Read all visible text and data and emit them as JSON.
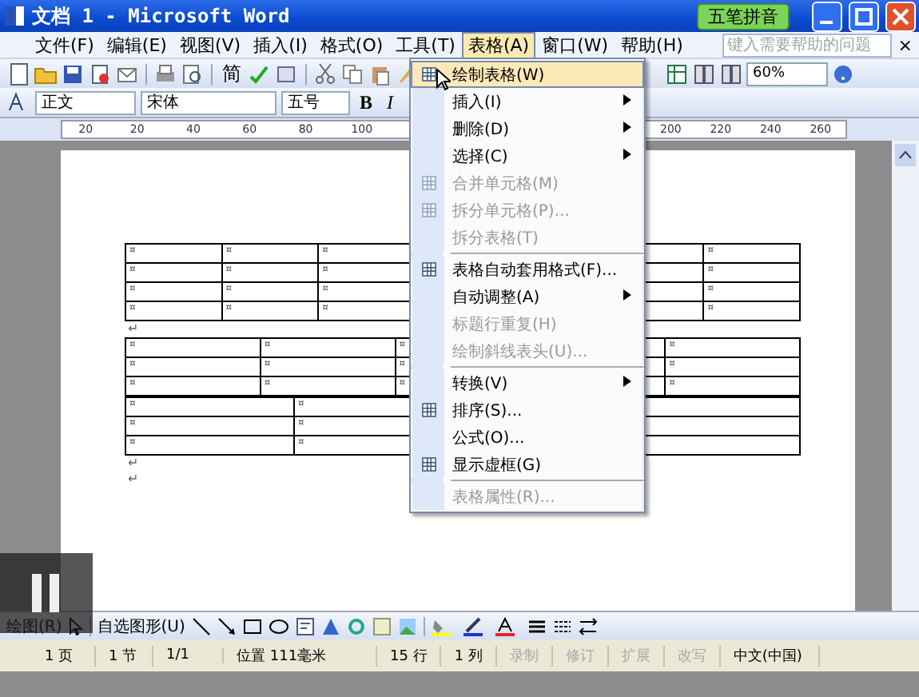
{
  "window": {
    "title": "文档 1 - Microsoft Word",
    "ime_badge": "五笔拼音"
  },
  "menubar": {
    "items": [
      {
        "label": "文件(F)",
        "selected": false
      },
      {
        "label": "编辑(E)",
        "selected": false
      },
      {
        "label": "视图(V)",
        "selected": false
      },
      {
        "label": "插入(I)",
        "selected": false
      },
      {
        "label": "格式(O)",
        "selected": false
      },
      {
        "label": "工具(T)",
        "selected": false
      },
      {
        "label": "表格(A)",
        "selected": true
      },
      {
        "label": "窗口(W)",
        "selected": false
      },
      {
        "label": "帮助(H)",
        "selected": false
      }
    ],
    "help_box": {
      "placeholder": "键入需要帮助的问题"
    },
    "close_document": "×"
  },
  "standard_toolbar": {
    "convert_label": "简",
    "zoom": "60%"
  },
  "format_toolbar": {
    "style": "正文",
    "font": "宋体",
    "size": "五号",
    "bold": "B",
    "italic": "I"
  },
  "ruler": {
    "left_labels": [
      "20",
      "20",
      "40",
      "60",
      "80",
      "100"
    ],
    "right_labels": [
      "200",
      "220",
      "240",
      "260"
    ]
  },
  "document": {
    "blocks": [
      {
        "kind": "table",
        "rows": [
          [
            "¤",
            "¤",
            "¤",
            null,
            null,
            null,
            "¤"
          ],
          [
            "¤",
            "¤",
            "¤",
            null,
            null,
            null,
            "¤"
          ],
          [
            "¤",
            "¤",
            "¤",
            null,
            null,
            null,
            "¤"
          ],
          [
            "¤",
            "¤",
            "¤",
            null,
            null,
            null,
            "¤"
          ]
        ]
      },
      {
        "kind": "paragraph",
        "text": "↵"
      },
      {
        "kind": "table",
        "rows": [
          [
            "¤",
            "¤",
            "¤",
            null,
            "¤"
          ],
          [
            "¤",
            "¤",
            "¤",
            null,
            "¤"
          ],
          [
            "¤",
            "¤",
            "¤",
            null,
            "¤"
          ]
        ]
      },
      {
        "kind": "table",
        "rows": [
          [
            "¤",
            "¤",
            null,
            null
          ],
          [
            "¤",
            "¤",
            null,
            null
          ],
          [
            "¤",
            "¤",
            null,
            null
          ]
        ]
      },
      {
        "kind": "paragraph",
        "text": "↵"
      },
      {
        "kind": "paragraph",
        "text": "↵"
      }
    ]
  },
  "table_menu": {
    "items": [
      {
        "kind": "item",
        "label": "绘制表格(W)",
        "selected": true,
        "disabled": false,
        "submenu": false,
        "has_icon": true
      },
      {
        "kind": "item",
        "label": "插入(I)",
        "selected": false,
        "disabled": false,
        "submenu": true,
        "has_icon": false
      },
      {
        "kind": "item",
        "label": "删除(D)",
        "selected": false,
        "disabled": false,
        "submenu": true,
        "has_icon": false
      },
      {
        "kind": "item",
        "label": "选择(C)",
        "selected": false,
        "disabled": false,
        "submenu": true,
        "has_icon": false
      },
      {
        "kind": "item",
        "label": "合并单元格(M)",
        "selected": false,
        "disabled": true,
        "submenu": false,
        "has_icon": true
      },
      {
        "kind": "item",
        "label": "拆分单元格(P)...",
        "selected": false,
        "disabled": true,
        "submenu": false,
        "has_icon": true
      },
      {
        "kind": "item",
        "label": "拆分表格(T)",
        "selected": false,
        "disabled": true,
        "submenu": false,
        "has_icon": false
      },
      {
        "kind": "separator"
      },
      {
        "kind": "item",
        "label": "表格自动套用格式(F)...",
        "selected": false,
        "disabled": false,
        "submenu": false,
        "has_icon": true
      },
      {
        "kind": "item",
        "label": "自动调整(A)",
        "selected": false,
        "disabled": false,
        "submenu": true,
        "has_icon": false
      },
      {
        "kind": "item",
        "label": "标题行重复(H)",
        "selected": false,
        "disabled": true,
        "submenu": false,
        "has_icon": false
      },
      {
        "kind": "item",
        "label": "绘制斜线表头(U)...",
        "selected": false,
        "disabled": true,
        "submenu": false,
        "has_icon": false
      },
      {
        "kind": "separator"
      },
      {
        "kind": "item",
        "label": "转换(V)",
        "selected": false,
        "disabled": false,
        "submenu": true,
        "has_icon": false
      },
      {
        "kind": "item",
        "label": "排序(S)...",
        "selected": false,
        "disabled": false,
        "submenu": false,
        "has_icon": true
      },
      {
        "kind": "item",
        "label": "公式(O)...",
        "selected": false,
        "disabled": false,
        "submenu": false,
        "has_icon": false
      },
      {
        "kind": "item",
        "label": "显示虚框(G)",
        "selected": false,
        "disabled": false,
        "submenu": false,
        "has_icon": true
      },
      {
        "kind": "separator"
      },
      {
        "kind": "item",
        "label": "表格属性(R)...",
        "selected": false,
        "disabled": true,
        "submenu": false,
        "has_icon": false
      }
    ]
  },
  "drawing_toolbar": {
    "draw_menu": "绘图(R)",
    "autoshapes_menu": "自选图形(U)"
  },
  "status_bar": {
    "cells": [
      {
        "text": "1 页",
        "disabled": false
      },
      {
        "text": "1 节",
        "disabled": false
      },
      {
        "text": "1/1",
        "disabled": false
      },
      {
        "text": "位置 111毫米",
        "disabled": false
      },
      {
        "text": "15 行",
        "disabled": false
      },
      {
        "text": "1 列",
        "disabled": false
      },
      {
        "text": "录制",
        "disabled": true
      },
      {
        "text": "修订",
        "disabled": true
      },
      {
        "text": "扩展",
        "disabled": true
      },
      {
        "text": "改写",
        "disabled": true
      },
      {
        "text": "中文(中国)",
        "disabled": false
      }
    ]
  }
}
